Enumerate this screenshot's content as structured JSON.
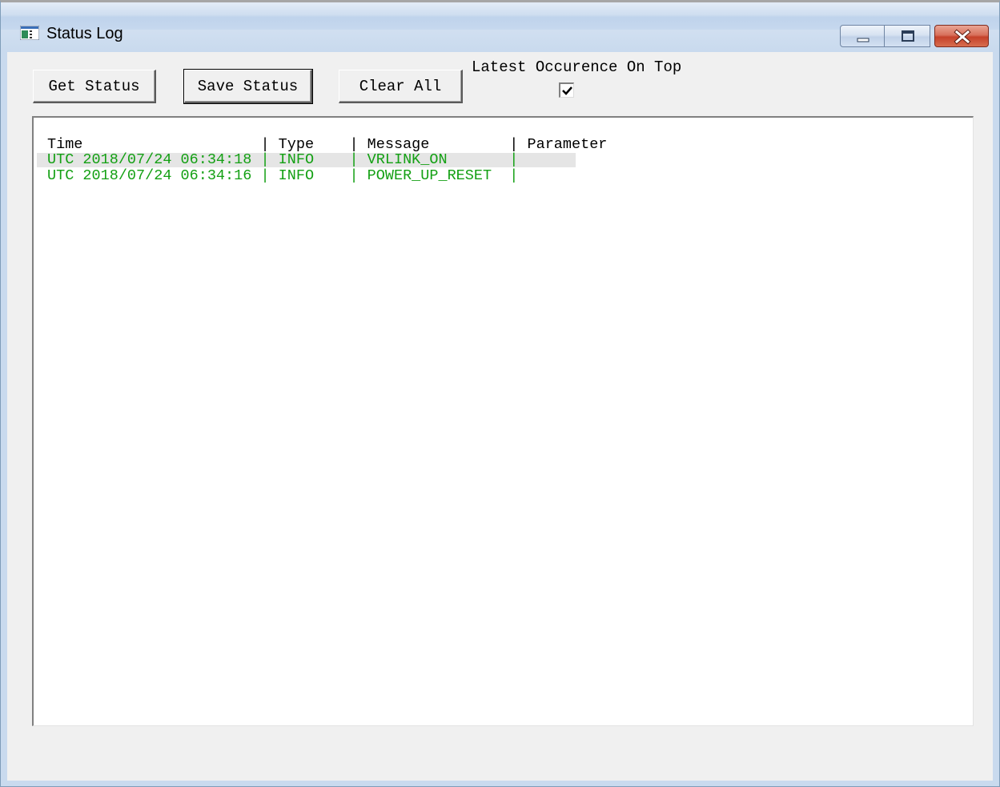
{
  "window": {
    "title": "Status Log",
    "icons": {
      "app": "status-log-app-icon",
      "minimize": "minimize-icon",
      "maximize": "maximize-icon",
      "close": "close-icon"
    }
  },
  "toolbar": {
    "get_status_label": "Get Status",
    "save_status_label": "Save Status",
    "clear_all_label": "Clear All",
    "latest_on_top_label": "Latest Occurence On Top",
    "latest_on_top_checked": true
  },
  "log": {
    "header": "Time                    | Type    | Message         | Parameter",
    "columns": [
      "Time",
      "Type",
      "Message",
      "Parameter"
    ],
    "rows": [
      {
        "line": "UTC 2018/07/24 06:34:18 | INFO    | VRLINK_ON       |",
        "time": "UTC 2018/07/24 06:34:18",
        "type": "INFO",
        "message": "VRLINK_ON",
        "parameter": "",
        "selected": true
      },
      {
        "line": "UTC 2018/07/24 06:34:16 | INFO    | POWER_UP_RESET  |",
        "time": "UTC 2018/07/24 06:34:16",
        "type": "INFO",
        "message": "POWER_UP_RESET",
        "parameter": "",
        "selected": false
      }
    ],
    "colors": {
      "info_text": "#14a014",
      "header_text": "#000000",
      "selected_row_bg": "#e5e5e5"
    }
  }
}
